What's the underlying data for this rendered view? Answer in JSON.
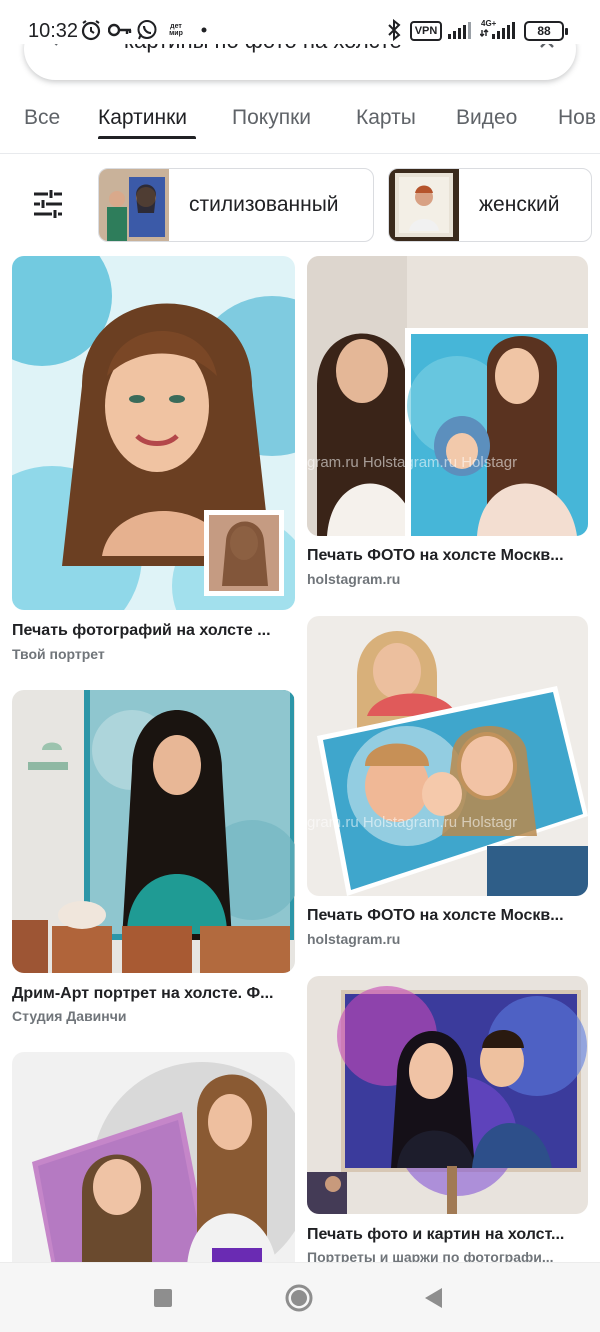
{
  "status_bar": {
    "time": "10:32",
    "notification_icons": [
      "alarm-icon",
      "key-icon",
      "whatsapp-icon",
      "detmir-icon",
      "dot-icon"
    ],
    "detmir_text": "дет мир",
    "vpn_label": "VPN",
    "network_label": "4G+",
    "battery_level": "88"
  },
  "search": {
    "query": "картины по фото на холсте"
  },
  "tabs": [
    {
      "label": "Все",
      "active": false
    },
    {
      "label": "Картинки",
      "active": true
    },
    {
      "label": "Покупки",
      "active": false
    },
    {
      "label": "Карты",
      "active": false
    },
    {
      "label": "Видео",
      "active": false
    },
    {
      "label": "Нов",
      "active": false
    }
  ],
  "chips": [
    {
      "label": "стилизованный"
    },
    {
      "label": "женский"
    }
  ],
  "results": [
    {
      "title": "Печать фотографий на холсте ...",
      "source": "Твой портрет",
      "watermark": ""
    },
    {
      "title": "Печать ФОТО на холсте Москв...",
      "source": "holstagram.ru",
      "watermark": "gram.ru   Holstagram.ru   Holstagr"
    },
    {
      "title": "Дрим-Арт портрет на холсте. Ф...",
      "source": "Студия Давинчи",
      "watermark": ""
    },
    {
      "title": "Печать ФОТО на холсте Москв...",
      "source": "holstagram.ru",
      "watermark": "gram.ru   Holstagram.ru   Holstagr"
    },
    {
      "title": "",
      "source": "",
      "watermark": ""
    },
    {
      "title": "Печать фото и картин на холст...",
      "source": "Портреты и шаржи по фотографи...",
      "watermark": ""
    }
  ],
  "colors": {
    "accent": "#202124",
    "secondary_text": "#70757a",
    "tab_inactive": "#5f6368"
  }
}
